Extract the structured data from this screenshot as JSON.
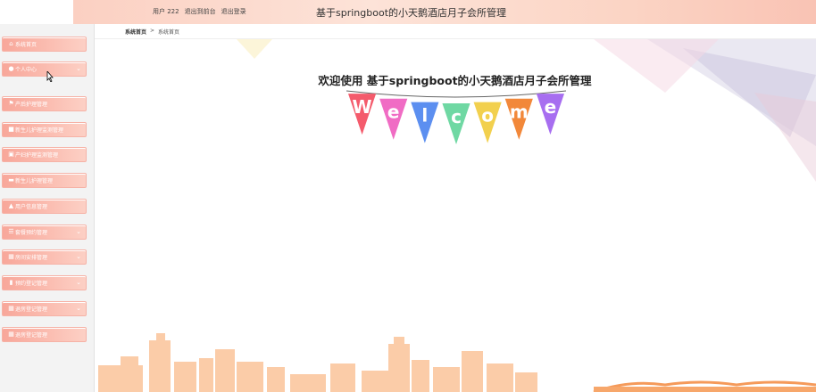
{
  "header": {
    "user_label": "用户 222",
    "back_link": "退出到前台",
    "logout_link": "退出登录",
    "app_title": "基于springboot的小天鹅酒店月子会所管理"
  },
  "breadcrumb": {
    "home": "系统首页",
    "separator": ">",
    "current": "系统首页"
  },
  "sidebar": {
    "items": [
      {
        "label": "系统首页",
        "icon": "home-icon",
        "has_chevron": false
      },
      {
        "label": "个人中心",
        "icon": "user-icon",
        "has_chevron": true
      },
      {
        "label": "产后护理管理",
        "icon": "flag-icon",
        "has_chevron": false
      },
      {
        "label": "新生儿护理监测管理",
        "icon": "briefcase-icon",
        "has_chevron": false
      },
      {
        "label": "产妇护理监测管理",
        "icon": "clipboard-icon",
        "has_chevron": false
      },
      {
        "label": "新生儿护理管理",
        "icon": "folder-icon",
        "has_chevron": false
      },
      {
        "label": "用户信息管理",
        "icon": "person-icon",
        "has_chevron": false
      },
      {
        "label": "套餐预约管理",
        "icon": "list-icon",
        "has_chevron": true
      },
      {
        "label": "房间安排管理",
        "icon": "grid-icon",
        "has_chevron": true
      },
      {
        "label": "预约登记管理",
        "icon": "bar-chart-icon",
        "has_chevron": true
      },
      {
        "label": "退房登记管理",
        "icon": "grid-icon",
        "has_chevron": true
      },
      {
        "label": "退房登记管理",
        "icon": "grid-icon",
        "has_chevron": false
      }
    ]
  },
  "main": {
    "welcome_title": "欢迎使用 基于springboot的小天鹅酒店月子会所管理",
    "bunting_letters": [
      "W",
      "e",
      "l",
      "c",
      "o",
      "m",
      "e"
    ],
    "bunting_colors": [
      "#f45b6c",
      "#f06cc4",
      "#5c8ff0",
      "#6fd8a3",
      "#f2d04e",
      "#f2883a",
      "#a76ef0"
    ]
  },
  "colors": {
    "menu_bg": "#f8a79a",
    "header_bg": "#fde3d8",
    "skyline": "#f9b98f"
  }
}
